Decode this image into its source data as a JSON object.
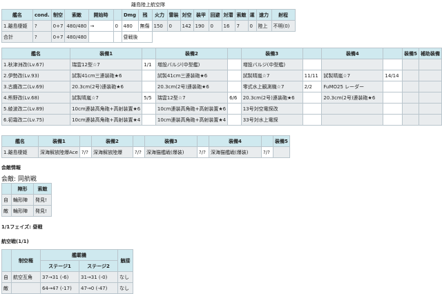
{
  "fleet_title": "離島陸上航空隊",
  "summary": {
    "headers": [
      "艦名",
      "cond.",
      "制空",
      "索敵",
      "開始時",
      "",
      "Dmg",
      "残",
      "火力",
      "雷装",
      "対空",
      "装甲",
      "回避",
      "対潜",
      "索敵",
      "運",
      "速力",
      "射程"
    ],
    "rows": [
      [
        "1.離島棲姫",
        "?",
        "0+7",
        "480/480",
        "→",
        "0",
        "480",
        "無傷",
        "150",
        "0",
        "142",
        "190",
        "0",
        "16",
        "7",
        "0",
        "陸上",
        "不明(0)"
      ],
      [
        "合計",
        "?",
        "0+7",
        "480/480",
        "",
        "",
        "昼戦後",
        "",
        "",
        "",
        "",
        "",
        "",
        "",
        "",
        "",
        "",
        ""
      ]
    ]
  },
  "equip": {
    "headers": [
      "艦名",
      "装備1",
      "",
      "装備2",
      "",
      "装備3",
      "",
      "装備4",
      "",
      "装備5",
      "補助装備"
    ],
    "rows": [
      [
        "1.秋津洲改(Lv.67)",
        "瑞雲12型☆7",
        "1/1",
        "増設バルジ(中型艦)",
        "",
        "増設バルジ(中型艦)",
        "",
        "",
        "",
        "",
        ""
      ],
      [
        "2.伊勢改(Lv.93)",
        "試製41cm三連装砲★6",
        "",
        "試製41cm三連装砲★6",
        "",
        "試製晴嵐☆7",
        "11/11",
        "試製晴嵐☆7",
        "14/14",
        "",
        ""
      ],
      [
        "3.古鷹改二(Lv.69)",
        "20.3cm(2号)連装砲★6",
        "",
        "20.3cm(2号)連装砲★6",
        "",
        "零式水上観測機☆7",
        "2/2",
        "FuMO25 レーダー",
        "",
        "",
        ""
      ],
      [
        "4.熊野改(Lv.68)",
        "試製晴嵐☆7",
        "5/5",
        "瑞雲12型☆7",
        "6/6",
        "20.3cm(2号)連装砲★6",
        "",
        "20.3cm(2号)連装砲★6",
        "",
        "",
        ""
      ],
      [
        "5.綾波改二(Lv.89)",
        "10cm連装高角砲+高射装置★6",
        "",
        "10cm連装高角砲+高射装置★6",
        "",
        "13号対空電探改",
        "",
        "",
        "",
        "",
        ""
      ],
      [
        "6.初霜改二(Lv.75)",
        "10cm連装高角砲+高射装置★4",
        "",
        "10cm連装高角砲+高射装置★4",
        "",
        "33号対水上電探",
        "",
        "",
        "",
        "",
        ""
      ]
    ]
  },
  "enemy_equip": {
    "headers": [
      "艦名",
      "装備1",
      "",
      "装備2",
      "",
      "装備3",
      "",
      "装備4",
      "",
      "装備5"
    ],
    "rows": [
      [
        "1.離島棲姫",
        "深海解放陸爆Ace",
        "?/?",
        "深海解放陸爆",
        "?/?",
        "深海猫艦戦(爆装)",
        "?/?",
        "深海猫艦戦(爆装)",
        "?/?",
        ""
      ]
    ]
  },
  "battle_info_label": "会敵情報",
  "formation": "会敵: 同航戦",
  "formation_table": {
    "headers": [
      "",
      "陣形",
      "索敵"
    ],
    "rows": [
      [
        "自",
        "輪形陣",
        "発見!"
      ],
      [
        "敵",
        "輪形陣",
        "発見!"
      ]
    ]
  },
  "phase_label": "1/1フェイズ: 昼戦",
  "air_label": "航空戦(1/1)",
  "air_table": {
    "h_top": [
      "",
      "制空権",
      "艦載機",
      "触接"
    ],
    "h_sub": [
      "ステージ1",
      "ステージ2"
    ],
    "rows": [
      [
        "自",
        "航空互角",
        "37→31 (-6)",
        "31→31 (-0)",
        "なし"
      ],
      [
        "敵",
        "",
        "64→47 (-17)",
        "47→0 (-47)",
        "なし"
      ]
    ]
  }
}
